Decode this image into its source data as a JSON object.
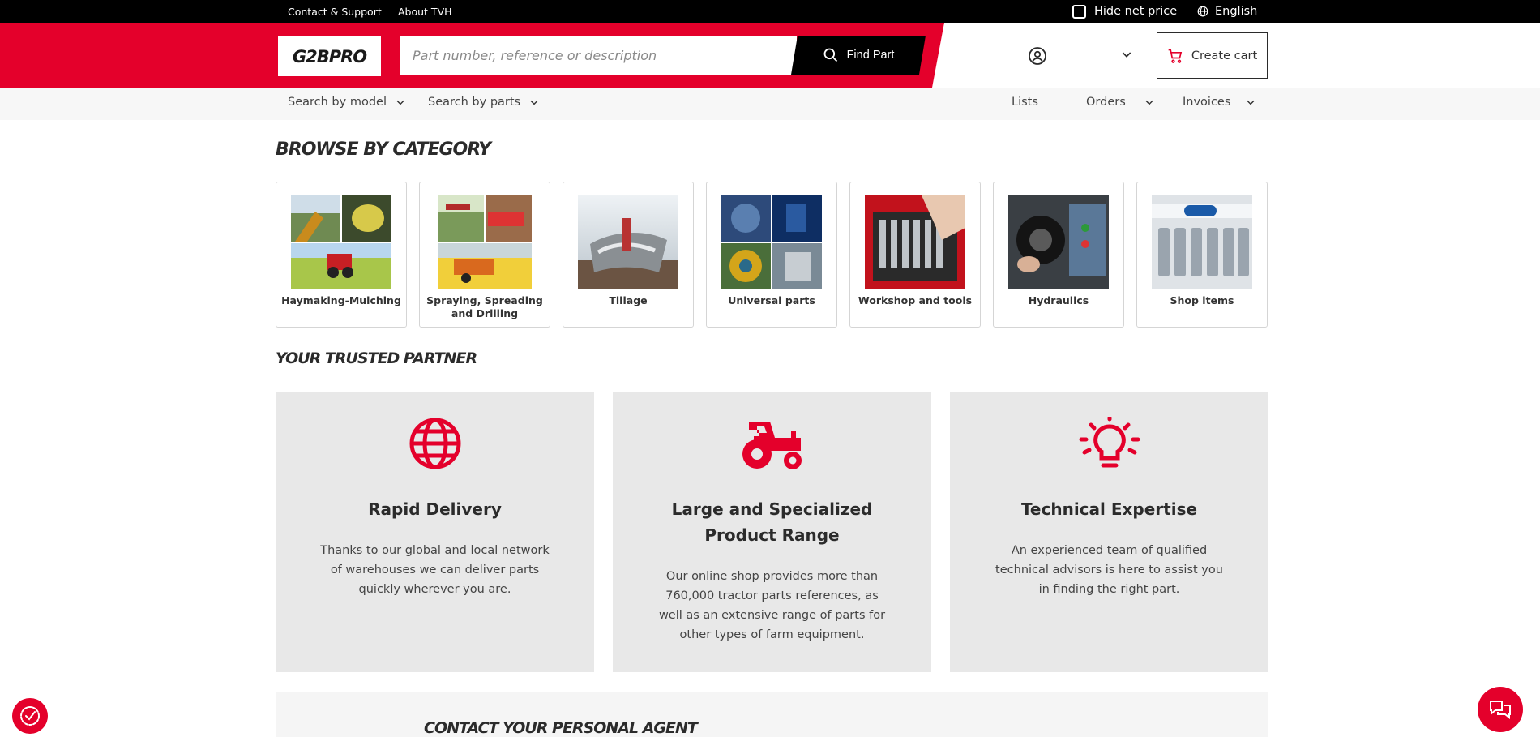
{
  "topbar": {
    "contact_support": "Contact & Support",
    "about": "About TVH",
    "hide_net_price": "Hide net price",
    "language": "English"
  },
  "header": {
    "logo": "G2BPRO",
    "search_placeholder": "Part number, reference or description",
    "find_part": "Find Part",
    "create_cart": "Create cart"
  },
  "nav": {
    "search_by_model": "Search by model",
    "search_by_parts": "Search by parts",
    "lists": "Lists",
    "orders": "Orders",
    "invoices": "Invoices"
  },
  "browse": {
    "title": "BROWSE BY CATEGORY",
    "categories": [
      {
        "label": "Haymaking-Mulching",
        "name": "haymaking-mulching"
      },
      {
        "label": "Spraying, Spreading and Drilling",
        "name": "spraying-spreading-drilling"
      },
      {
        "label": "Tillage",
        "name": "tillage"
      },
      {
        "label": "Universal parts",
        "name": "universal-parts"
      },
      {
        "label": "Workshop and tools",
        "name": "workshop-tools"
      },
      {
        "label": "Hydraulics",
        "name": "hydraulics"
      },
      {
        "label": "Shop items",
        "name": "shop-items"
      }
    ]
  },
  "partner": {
    "title": "YOUR TRUSTED PARTNER",
    "cards": [
      {
        "icon": "globe-icon",
        "title": "Rapid Delivery",
        "text": "Thanks to our global and local network of warehouses we can deliver parts quickly wherever you are."
      },
      {
        "icon": "tractor-icon",
        "title": "Large and Specialized Product Range",
        "text": "Our online shop provides more than 760,000 tractor parts references, as well as an extensive range of parts for other types of farm equipment."
      },
      {
        "icon": "lightbulb-icon",
        "title": "Technical Expertise",
        "text": "An experienced team of qualified technical advisors is here to assist you in finding the right part."
      }
    ]
  },
  "contact": {
    "title": "CONTACT YOUR PERSONAL AGENT"
  },
  "colors": {
    "brand_red": "#e4002b",
    "black": "#000000",
    "card_gray": "#e8e8e8",
    "nav_gray": "#f7f7f7"
  }
}
